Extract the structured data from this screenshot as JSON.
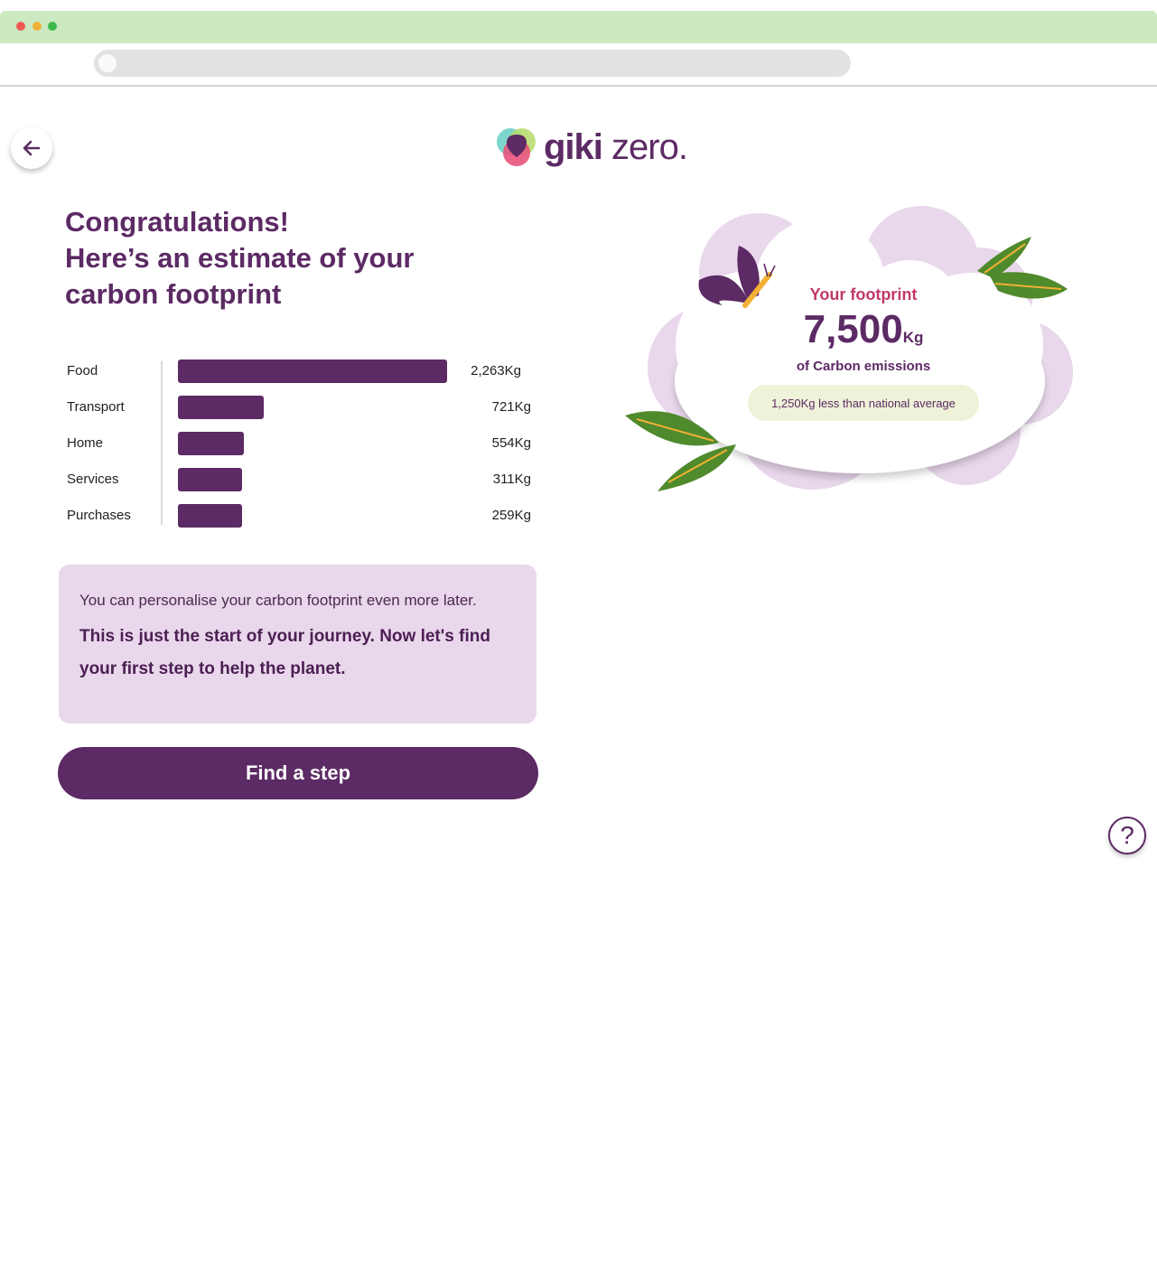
{
  "app": {
    "brand_giki": "giki",
    "brand_zero": "zero.",
    "icons": {
      "back": "arrow-left-icon",
      "help": "question-mark-icon",
      "logo": "giki-logo-icon"
    }
  },
  "colors": {
    "brand_purple": "#5c2a64",
    "accent_pink": "#c0386b",
    "panel_lilac": "#e9d7ec",
    "pill_green": "#eef2d8",
    "chrome_green": "#cce9c2"
  },
  "headline": {
    "line1": "Congratulations!",
    "line2": "Here’s an estimate of your",
    "line3": "carbon footprint"
  },
  "chart_data": {
    "type": "bar",
    "orientation": "horizontal",
    "categories": [
      "Food",
      "Transport",
      "Home",
      "Services",
      "Purchases"
    ],
    "values": [
      2263,
      721,
      554,
      311,
      259
    ],
    "value_labels": [
      "2,263Kg",
      "721Kg",
      "554Kg",
      "311Kg",
      "259Kg"
    ]
  },
  "info": {
    "line1": "You can personalise your carbon footprint even more later.",
    "line2": "This is just the start of your journey. Now let's find your first step to help the planet."
  },
  "cta": {
    "label": "Find a step"
  },
  "footprint": {
    "title": "Your footprint",
    "value": "7,500",
    "unit": "Kg",
    "subtitle": "of Carbon emissions",
    "comparison": "1,250Kg less than national average"
  },
  "help": {
    "label": "?"
  }
}
